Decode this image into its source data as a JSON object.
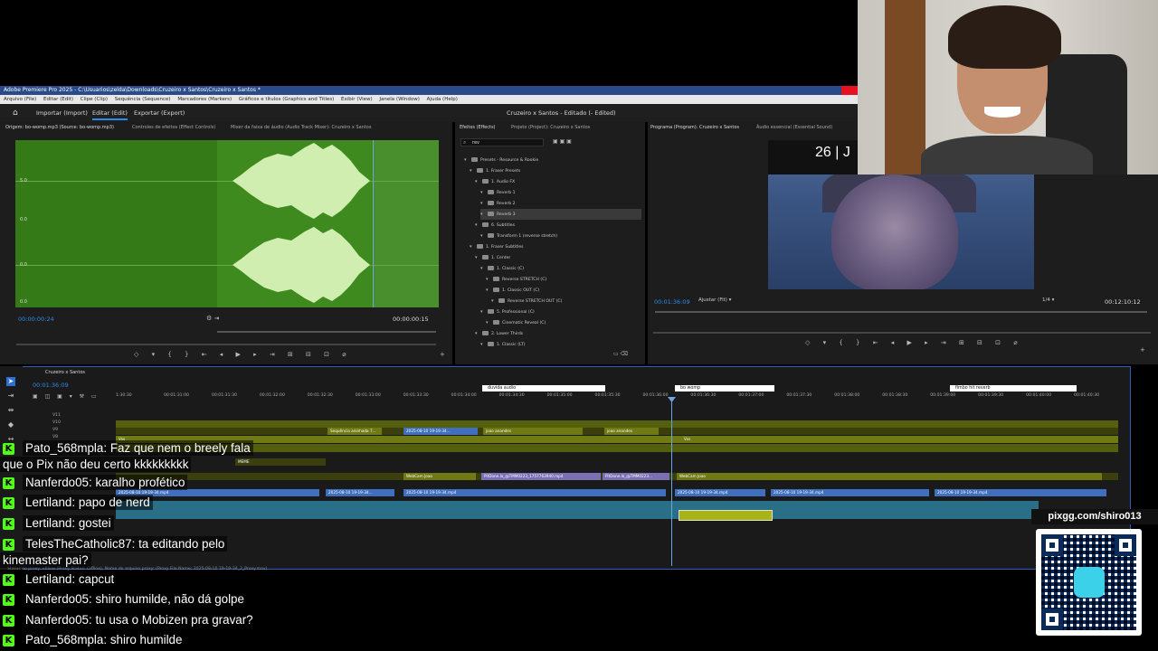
{
  "app": {
    "title": "Adobe Premiere Pro 2025 - C:\\Usuarios\\zelda\\Downloads\\Cruzeiro x Santos\\Cruzeiro x Santos *",
    "menu": [
      "Arquivo (File)",
      "Editar (Edit)",
      "Clipe (Clip)",
      "Sequência (Sequence)",
      "Marcadores (Markers)",
      "Gráficos e títulos (Graphics and Titles)",
      "Exibir (View)",
      "Janela (Window)",
      "Ajuda (Help)"
    ]
  },
  "workspace": {
    "tabs": [
      "Importar (Import)",
      "Editar (Edit)",
      "Exportar (Export)"
    ],
    "active": "Editar (Edit)",
    "project_title": "Cruzeiro x Santos - Editado (- Edited)"
  },
  "source": {
    "tabs": [
      "Origem: bo-womp.mp3 (Source: bo-womp.mp3)",
      "Controles de efeitos (Effect Controls)",
      "Mixer da faixa de áudio (Audio Track Mixer): Cruzeiro x Santos"
    ],
    "db_labels": [
      "5.0",
      "0.0",
      "0.0",
      "0.0"
    ],
    "timecode": "00:00:00:24",
    "duration": "00:00:00:15"
  },
  "effects": {
    "tabs": [
      "Efeitos (Effects)",
      "Projeto (Project): Cruzeiro x Santos"
    ],
    "search_value": "rev",
    "tree": [
      {
        "label": "Presets - Resource & Rookie",
        "depth": 0
      },
      {
        "label": "1. Fraser Presets",
        "depth": 1
      },
      {
        "label": "1. Audio FX",
        "depth": 2
      },
      {
        "label": "Reverb 1",
        "depth": 3
      },
      {
        "label": "Reverb 2",
        "depth": 3
      },
      {
        "label": "Reverb 3",
        "depth": 3,
        "selected": true
      },
      {
        "label": "6. Subtitles",
        "depth": 2
      },
      {
        "label": "Transform 1 (reverse stretch)",
        "depth": 3
      },
      {
        "label": "1. Fraser Subtitles",
        "depth": 1
      },
      {
        "label": "1. Center",
        "depth": 2
      },
      {
        "label": "1. Classic (C)",
        "depth": 3
      },
      {
        "label": "Reverse STRETCH (C)",
        "depth": 4
      },
      {
        "label": "1. Classic OUT (C)",
        "depth": 4
      },
      {
        "label": "Reverse STRETCH OUT (C)",
        "depth": 5
      },
      {
        "label": "5. Professional (C)",
        "depth": 3
      },
      {
        "label": "Cinematic Reveal (C)",
        "depth": 4
      },
      {
        "label": "2. Lower Thirds",
        "depth": 2
      },
      {
        "label": "1. Classic (LT)",
        "depth": 3
      }
    ]
  },
  "program": {
    "tabs": [
      "Programa (Program): Cruzeiro x Santos",
      "Áudio essencial (Essential Sound)"
    ],
    "overlay_text": "26 | J",
    "timecode": "00:01:36:09",
    "fit": "Ajustar (Fit)",
    "resolution": "1/4",
    "duration": "00:12:10:12"
  },
  "timeline": {
    "sequence": "Cruzeiro x Santos",
    "timecode": "00:01:36:09",
    "ruler_labels": [
      "1:30:30",
      "00:01:31:00",
      "00:01:31:30",
      "00:01:32:00",
      "00:01:32:30",
      "00:01:33:00",
      "00:01:33:30",
      "00:01:34:00",
      "00:01:34:30",
      "00:01:35:00",
      "00:01:35:30",
      "00:01:36:00",
      "00:01:36:30",
      "00:01:37:00",
      "00:01:37:30",
      "00:01:38:00",
      "00:01:38:30",
      "00:01:39:00",
      "00:01:39:30",
      "00:01:40:00",
      "00:01:40:30"
    ],
    "markers": [
      "duvida audio",
      "bo womp",
      "fimbo hit reverb"
    ],
    "track_labels": [
      "V11",
      "V10",
      "V9",
      "V8"
    ],
    "clips": {
      "v_a": [
        "Sequência aninhada 7...",
        "2025-08-10 19-19-34...",
        "joao anandes",
        "joao anandes"
      ],
      "v_b": [
        "Vss",
        "Vss"
      ],
      "v_c": [
        "MEME"
      ],
      "v_d": [
        "WebCam Joao",
        "PitDone.lo_@TMM0223_1757763940.mp4",
        "PitDone.lo_@TMM0223...",
        "WebCam Joao"
      ],
      "v_e": [
        "2025-08-10 19-19-34.mp4",
        "2025-08-10 19-19-34...",
        "2025-08-10 19-19-34.mp4",
        "2025-08-10 19-19-34.mp4",
        "2025-08-10 19-19-34.mp4",
        "2025-08-10 19-19-34.mp4"
      ]
    },
    "status": "Status do proxy: offline (Proxy Status: Offline), Nome do arquivo proxy: (Proxy File Name: 2025-08-10 19-19-34_2_Proxy.mov)"
  },
  "chat": [
    {
      "user": "Pato_568mpla",
      "msg": "Faz que nem o breely fala",
      "cont": "que o Pix não deu certo kkkkkkkkk"
    },
    {
      "user": "Nanferdo05",
      "msg": "karalho profético"
    },
    {
      "user": "Lertiland",
      "msg": "papo de nerd"
    },
    {
      "user": "Lertiland",
      "msg": "gostei"
    },
    {
      "user": "TelesTheCatholic87",
      "msg": "ta editando pelo",
      "cont": "kinemaster pai?"
    },
    {
      "user": "Lertiland",
      "msg": "capcut"
    },
    {
      "user": "Nanferdo05",
      "msg": "shiro humilde, não dá golpe"
    },
    {
      "user": "Nanferdo05",
      "msg": "tu usa o Mobizen pra gravar?"
    },
    {
      "user": "Pato_568mpla",
      "msg": "shiro humilde"
    }
  ],
  "donation": {
    "url": "pixgg.com/shiro013"
  },
  "colors": {
    "accent": "#2d8ceb",
    "kick_green": "#53fc18",
    "waveform_bg": "#3f8a1e"
  }
}
